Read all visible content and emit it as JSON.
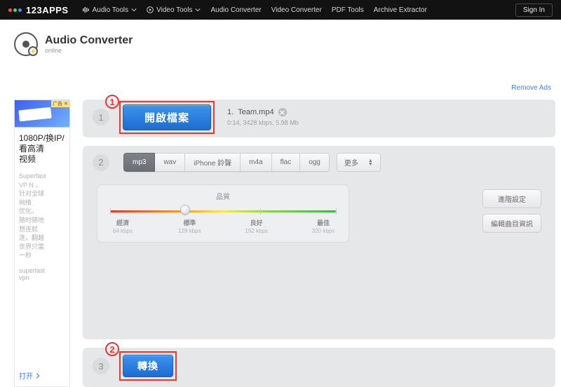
{
  "header": {
    "logo_text": "123APPS",
    "nav": [
      {
        "label": "Audio Tools",
        "has_dropdown": true
      },
      {
        "label": "Video Tools",
        "has_dropdown": true
      },
      {
        "label": "Audio Converter",
        "has_dropdown": false
      },
      {
        "label": "Video Converter",
        "has_dropdown": false
      },
      {
        "label": "PDF Tools",
        "has_dropdown": false
      },
      {
        "label": "Archive Extractor",
        "has_dropdown": false
      }
    ],
    "signin_label": "Sign In"
  },
  "page": {
    "title": "Audio Converter",
    "subtitle": "online",
    "remove_ads": "Remove Ads"
  },
  "ad": {
    "tag": "广告 ✕",
    "title": "1080P/换IP/看高清\n视频",
    "description": "Superfast\nVP N ，\n针对全球\n网络\n优化，\n随时随地\n想连就\n连，翻越\n世界只需\n一秒",
    "brand": "superfast\nvpn",
    "link_label": "打开"
  },
  "annotations": {
    "a1": "1",
    "a2": "2"
  },
  "step1": {
    "number": "1",
    "open_label": "開啟檔案",
    "file_index": "1.",
    "file_name": "Team.mp4",
    "file_meta": "0:14, 3428 kbps, 5.98 Mb"
  },
  "step2": {
    "number": "2",
    "formats": [
      "mp3",
      "wav",
      "iPhone 鈴聲",
      "m4a",
      "flac",
      "ogg"
    ],
    "active_format": "mp3",
    "more_label": "更多",
    "quality_title": "品質",
    "quality_stops": [
      {
        "label": "經濟",
        "sub": "64 kbps"
      },
      {
        "label": "標準",
        "sub": "128 kbps"
      },
      {
        "label": "良好",
        "sub": "192 kbps"
      },
      {
        "label": "最佳",
        "sub": "320 kbps"
      }
    ],
    "quality_value_pct": 33,
    "advanced_label": "進階設定",
    "edit_label": "編輯曲目資訊"
  },
  "step3": {
    "number": "3",
    "convert_label": "轉換"
  }
}
